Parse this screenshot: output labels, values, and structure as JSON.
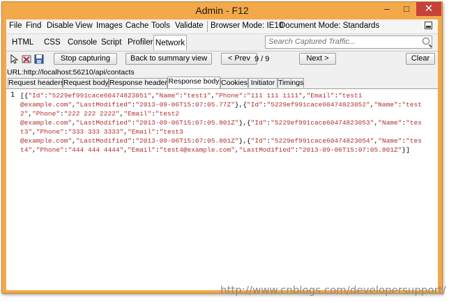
{
  "window": {
    "title": "Admin - F12"
  },
  "menu": {
    "items": [
      "File",
      "Find",
      "Disable",
      "View",
      "Images",
      "Cache",
      "Tools",
      "Validate"
    ],
    "browser_mode": "Browser Mode: IE10",
    "document_mode": "Document Mode: Standards"
  },
  "tabs": [
    "HTML",
    "CSS",
    "Console",
    "Script",
    "Profiler",
    "Network"
  ],
  "active_tab": "Network",
  "search": {
    "placeholder": "Search Captured Traffic..."
  },
  "toolbar": {
    "stop_label": "Stop capturing",
    "summary_label": "Back to summary view",
    "prev_label": "< Prev",
    "count": "9 / 9",
    "next_label": "Next >",
    "clear_label": "Clear"
  },
  "url": "URL:http://localhost:56210/api/contacts",
  "subtabs": [
    "Request headers",
    "Request body",
    "Response headers",
    "Response body",
    "Cookies",
    "Initiator",
    "Timings"
  ],
  "active_subtab": "Response body",
  "editor": {
    "line_number": "1",
    "lines": [
      "[{\"Id\":\"5229ef991cace60474823051\",\"Name\":\"test1\",\"Phone\":\"111 111 1111\",\"Email\":\"test1",
      "@example.com\",\"LastModified\":\"2013-09-06T15:07:05.77Z\"},{\"Id\":\"5229ef991cace60474823052\",\"Name\":\"test",
      "2\",\"Phone\":\"222 222 2222\",\"Email\":\"test2",
      "@example.com\",\"LastModified\":\"2013-09-06T15:07:05.801Z\"},{\"Id\":\"5229ef991cace60474823053\",\"Name\":\"tes",
      "t3\",\"Phone\":\"333 333 3333\",\"Email\":\"test3",
      "@example.com\",\"LastModified\":\"2013-09-06T15:07:05.801Z\"},{\"Id\":\"5229ef991cace60474823054\",\"Name\":\"tes",
      "t4\",\"Phone\":\"444 444 4444\",\"Email\":\"test4@example.com\",\"LastModified\":\"2013-09-06T15:07:05.801Z\"}]"
    ]
  },
  "watermark": "http://www.cnblogs.com/developersupport/",
  "colors": {
    "titlebar": "#f3a94a",
    "close_button": "#c7413b",
    "json_string": "#b03030"
  }
}
